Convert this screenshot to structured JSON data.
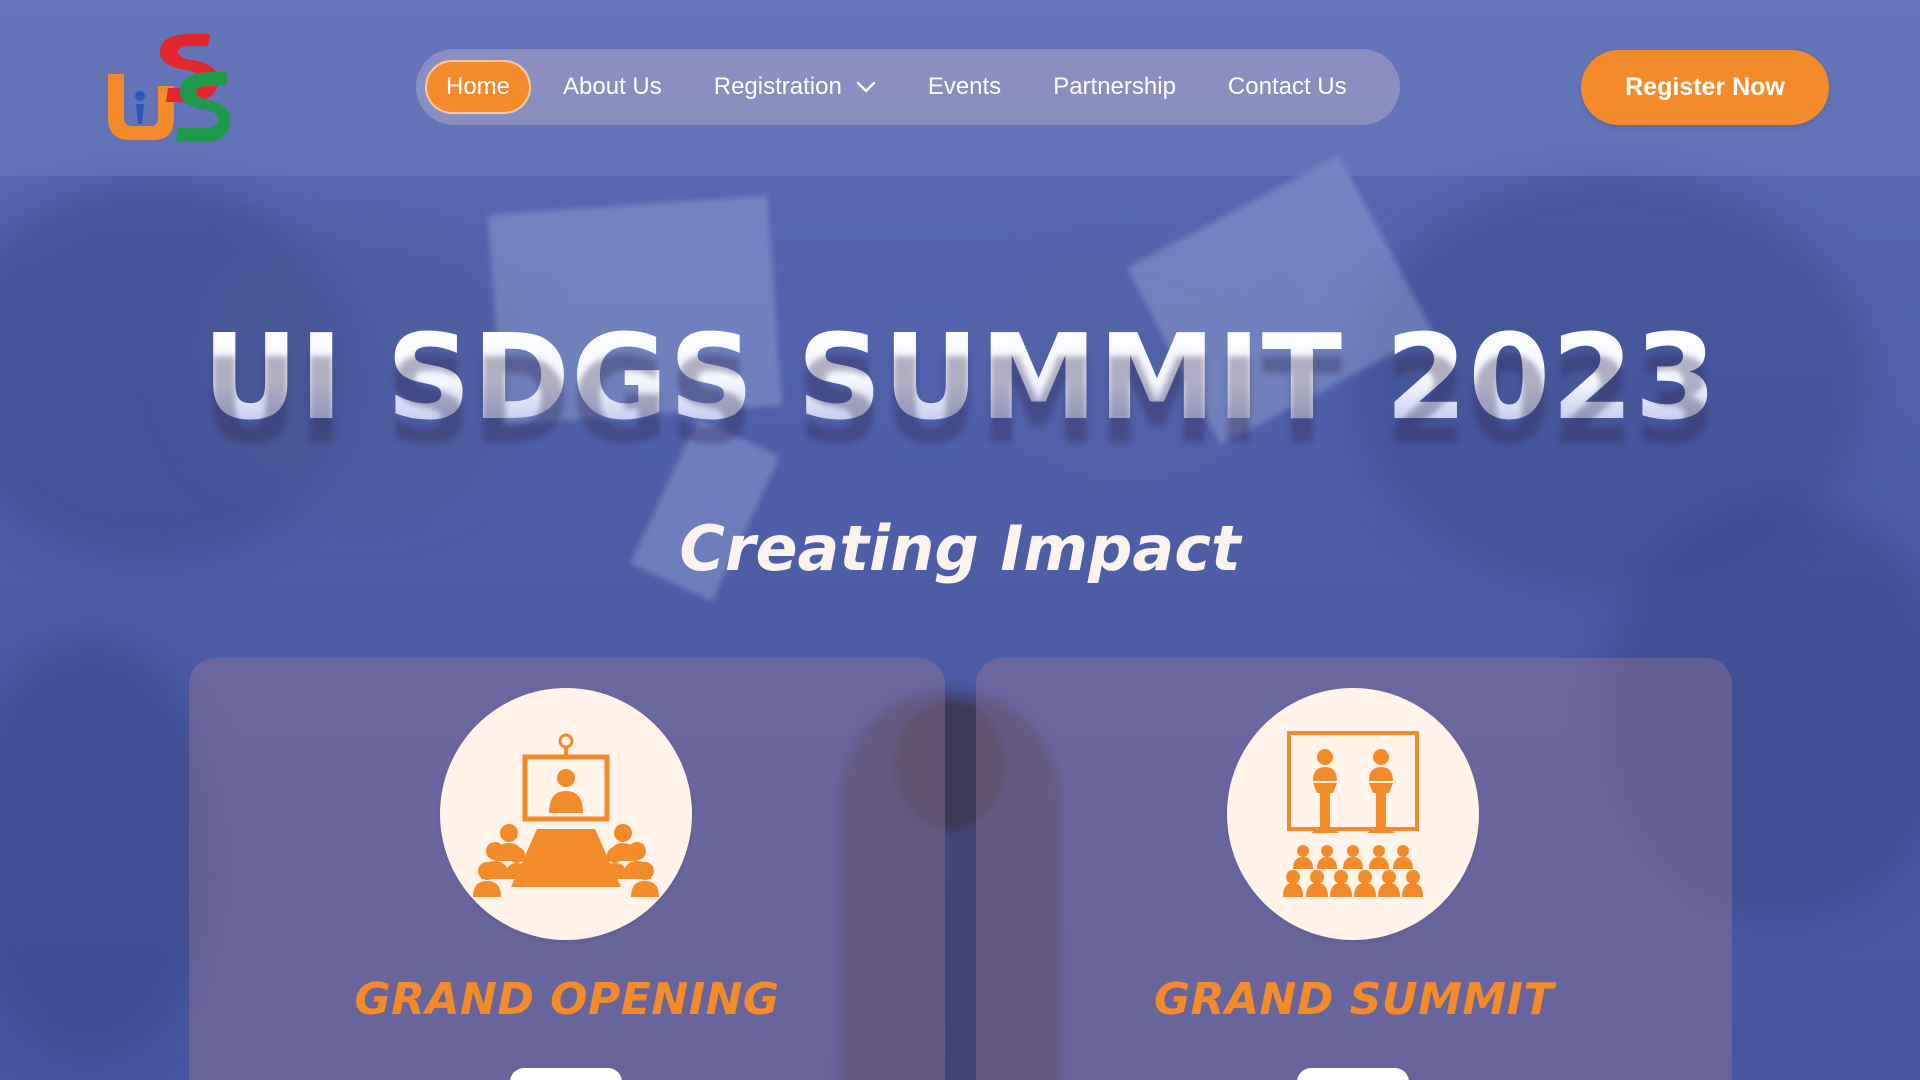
{
  "brand": {
    "logo_icon": "uisdgs-logo-icon",
    "colors": {
      "accent": "#f38b2b",
      "hero_overlay": "#5b6cb4",
      "card_title": "#f38b2b",
      "icon_circle": "#fff3ea"
    }
  },
  "nav": {
    "items": [
      {
        "label": "Home",
        "active": true
      },
      {
        "label": "About Us",
        "active": false
      },
      {
        "label": "Registration",
        "active": false,
        "dropdown_icon": "chevron-down-icon"
      },
      {
        "label": "Events",
        "active": false
      },
      {
        "label": "Partnership",
        "active": false
      },
      {
        "label": "Contact Us",
        "active": false
      }
    ],
    "cta_label": "Register Now"
  },
  "hero": {
    "title": "UI SDGS SUMMIT 2023",
    "subtitle": "Creating Impact"
  },
  "cards": [
    {
      "title": "GRAND OPENING",
      "icon": "video-conference-icon"
    },
    {
      "title": "GRAND SUMMIT",
      "icon": "podium-audience-icon"
    }
  ]
}
